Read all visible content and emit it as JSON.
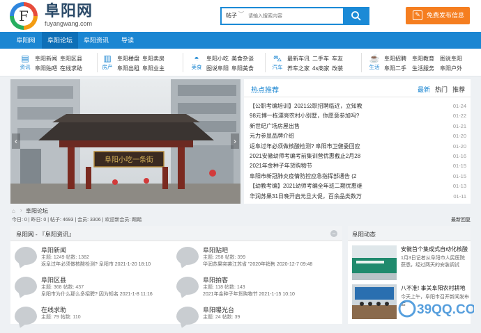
{
  "header": {
    "logo_letter": "F",
    "brand_name": "阜阳网",
    "brand_url": "fuyangwang.com",
    "search": {
      "type": "帖子",
      "placeholder": "请输入搜索内容"
    },
    "post_button": "免费发布信息",
    "colors": {
      "accent": "#1b86d2",
      "post": "#f57e20"
    }
  },
  "nav": [
    "阜阳网",
    "阜阳论坛",
    "阜阳资讯",
    "导读"
  ],
  "nav_active": "阜阳论坛",
  "categories": [
    {
      "icon": "news-icon",
      "caption": "资讯",
      "links": [
        "阜阳新闻",
        "阜阳区县",
        "阜阳贴吧",
        "在线求助"
      ]
    },
    {
      "icon": "house-icon",
      "caption": "房产",
      "links": [
        "阜阳楼盘",
        "阜阳卖房",
        "阜阳出租",
        "阜阳业主"
      ]
    },
    {
      "icon": "food-icon",
      "caption": "美食",
      "links": [
        "阜阳小吃",
        "美食杂谈",
        "图说阜阳",
        "阜阳美食"
      ]
    },
    {
      "icon": "car-icon",
      "caption": "汽车",
      "links": [
        "最新车讯",
        "二手车",
        "养车之家",
        "4s商家",
        "车友",
        "改装"
      ]
    },
    {
      "icon": "life-icon",
      "caption": "生活",
      "links": [
        "阜阳招聘",
        "阜阳教育",
        "图说阜阳",
        "阜阳二手",
        "生活服务",
        "阜阳户外"
      ]
    }
  ],
  "slider": {
    "sign_text": "阜阳小吃一条街"
  },
  "hot": {
    "title": "热点推荐",
    "tabs": [
      "最新",
      "热门",
      "推荐"
    ],
    "active_tab": "最新",
    "items": [
      {
        "title": "【公职考编培训】2021公职招聘临近，立知教",
        "date": "01-24"
      },
      {
        "title": "98元博一栋漂亮农村小别墅，你愿意参加吗?",
        "date": "01-22"
      },
      {
        "title": "新世纪广场房屋出售",
        "date": "01-21"
      },
      {
        "title": "元力参显品牌介绍",
        "date": "01-20"
      },
      {
        "title": "返阜过年必须做核酸检测? 阜阳市卫健委回应",
        "date": "01-20"
      },
      {
        "title": "2021安徽幼师考编考前集训营优惠截止2月28",
        "date": "01-16"
      },
      {
        "title": "2021年金种子年货购物节",
        "date": "01-15"
      },
      {
        "title": "阜阳市新冠肺炎疫情防控应急指挥部通告 (2",
        "date": "01-15"
      },
      {
        "title": "【幼教考编】2021幼师考编全年班二期优惠继",
        "date": "01-13"
      },
      {
        "title": "华润苏果31日晚开启元旦大促，百余品类数万",
        "date": "01-11"
      }
    ]
  },
  "breadcrumb": {
    "label": "阜阳论坛",
    "stats": "今日: 0 | 昨日: 0 | 帖子: 4693 | 会员: 3306 | 欢迎新会员: 踢踏",
    "latest": "最新回复"
  },
  "forum": {
    "title": "阜阳网 - 『阜阳资讯』",
    "boards": [
      {
        "name": "阜阳新闻",
        "meta": "主题: 1249  帖数: 1382",
        "last": "返阜过年必须做核酸检测? 阜阳市 2021-1-20 18:10"
      },
      {
        "name": "阜阳贴吧",
        "meta": "主题: 258  帖数: 399",
        "last": "华润苏果突袭江苏省 \"2020年销售 2020-12-7 09:48"
      },
      {
        "name": "阜阳区县",
        "meta": "主题: 368  帖数: 437",
        "last": "阜阳市为什么那么多招聘? 因为知名 2021-1-8 11:16"
      },
      {
        "name": "阜阳拍客",
        "meta": "主题: 118  帖数: 143",
        "last": "2021年金种子年货购物节 2021-1-15 10:10"
      },
      {
        "name": "在线求助",
        "meta": "主题: 79  帖数: 110",
        "last": ""
      },
      {
        "name": "阜阳曝光台",
        "meta": "主题: 24  帖数: 39",
        "last": ""
      }
    ]
  },
  "news": {
    "title": "阜阳动态",
    "items": [
      {
        "headline": "安徽首个集成式自动化核酸",
        "summary": "1月3日记者从阜阳市人民医院获悉，经过两天的安装调试"
      },
      {
        "headline": "八不准! 事关阜阳农村耕地",
        "summary": "今天上午，阜阳市召开新闻发布会"
      }
    ]
  },
  "watermark": "39QQ.COM"
}
